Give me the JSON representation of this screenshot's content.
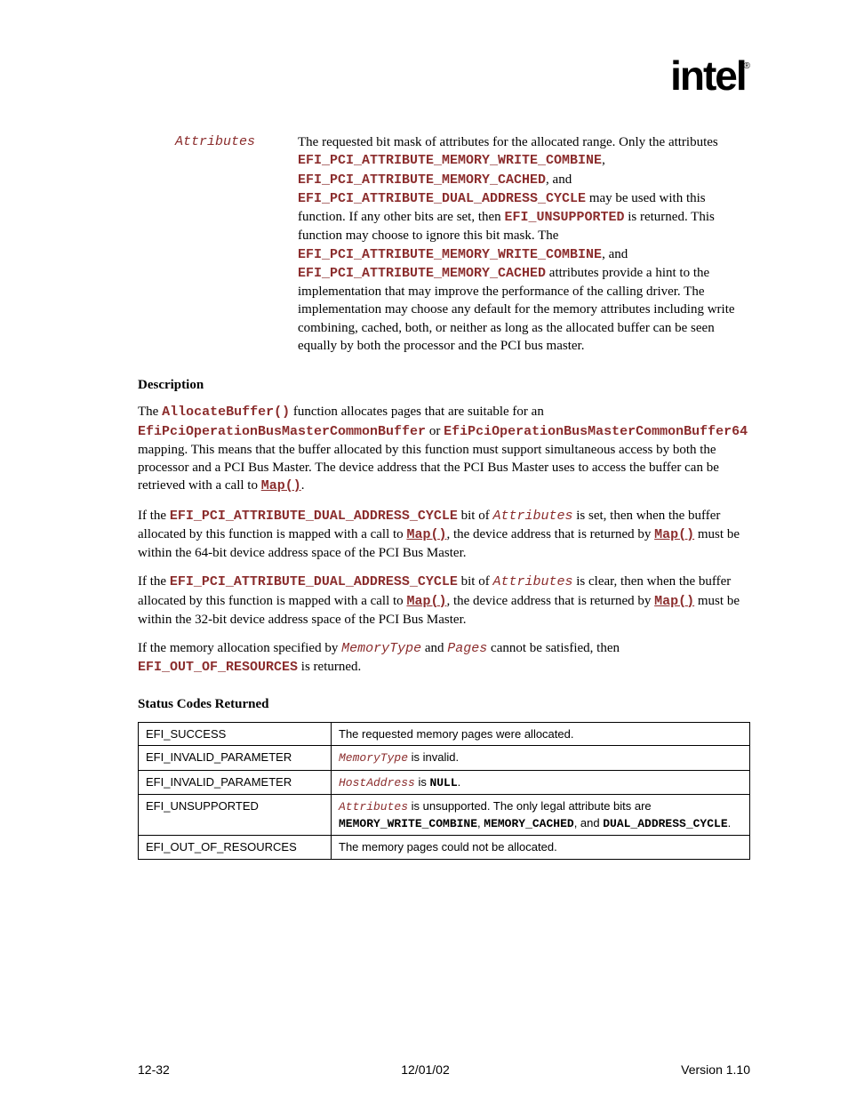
{
  "logo_text": "intel",
  "param": {
    "name": "Attributes",
    "intro1": "The requested bit mask of attributes for the allocated range.  Only the attributes ",
    "const1": "EFI_PCI_ATTRIBUTE_MEMORY_WRITE_COMBINE",
    "sep1": ", ",
    "const2": "EFI_PCI_ATTRIBUTE_MEMORY_CACHED",
    "sep2": ", and ",
    "const3": "EFI_PCI_ATTRIBUTE_DUAL_ADDRESS_CYCLE",
    "text2": " may be used with this function.  If any other bits are set, then ",
    "const4": "EFI_UNSUPPORTED",
    "text3": " is returned.  This function may choose to ignore this bit mask.  The ",
    "const5": "EFI_PCI_ATTRIBUTE_MEMORY_WRITE_COMBINE",
    "sep3": ", and ",
    "const6": "EFI_PCI_ATTRIBUTE_MEMORY_CACHED",
    "text4": " attributes provide a hint to the implementation that may improve the performance of the calling driver.  The implementation may choose any default for the memory attributes including write combining, cached, both, or neither as long as the allocated buffer can be seen equally by both the processor and the PCI bus master."
  },
  "heading1": "Description",
  "p1": {
    "t1": "The ",
    "c1": "AllocateBuffer()",
    "t2": " function allocates pages that are suitable for an ",
    "c2": "EfiPciOperationBusMasterCommonBuffer",
    "t3": " or ",
    "c3": "EfiPciOperationBusMasterCommonBuffer64",
    "t4": " mapping.  This means that the buffer allocated by this function must support simultaneous access by both the processor and a PCI Bus Master.  The device address that the PCI Bus Master uses to access the buffer can be retrieved with a call to ",
    "c4": "Map()",
    "t5": "."
  },
  "p2": {
    "t1": "If the ",
    "c1": "EFI_PCI_ATTRIBUTE_DUAL_ADDRESS_CYCLE",
    "t2": " bit of ",
    "c2": "Attributes",
    "t3": " is set, then when the buffer allocated by this function is mapped with a call to ",
    "c3": "Map()",
    "t4": ", the device address that is returned by ",
    "c4": "Map()",
    "t5": " must be within the 64-bit device address space of the PCI Bus Master."
  },
  "p3": {
    "t1": "If the ",
    "c1": "EFI_PCI_ATTRIBUTE_DUAL_ADDRESS_CYCLE",
    "t2": " bit of ",
    "c2": "Attributes",
    "t3": " is clear, then when the buffer allocated by this function is mapped with a call to ",
    "c3": "Map()",
    "t4": ", the device address that is returned by ",
    "c4": "Map()",
    "t5": " must be within the 32-bit device address space of the PCI Bus Master."
  },
  "p4": {
    "t1": "If the memory allocation specified by ",
    "c1": "MemoryType",
    "t2": " and ",
    "c2": "Pages",
    "t3": " cannot be satisfied, then ",
    "c3": "EFI_OUT_OF_RESOURCES",
    "t4": " is returned."
  },
  "heading2": "Status Codes Returned",
  "status": [
    {
      "code": "EFI_SUCCESS",
      "plain": "The requested memory pages were allocated."
    },
    {
      "code": "EFI_INVALID_PARAMETER",
      "m1": "MemoryType",
      "t1": " is invalid."
    },
    {
      "code": "EFI_INVALID_PARAMETER",
      "m1": "HostAddress",
      "t1": " is ",
      "m2": "NULL",
      "t2": "."
    },
    {
      "code": "EFI_UNSUPPORTED",
      "m1": "Attributes",
      "t1": " is unsupported.  The only legal attribute bits are ",
      "m2": "MEMORY_WRITE_COMBINE",
      "t2": ", ",
      "m3": "MEMORY_CACHED",
      "t3": ", and ",
      "m4": "DUAL_ADDRESS_CYCLE",
      "t4": "."
    },
    {
      "code": "EFI_OUT_OF_RESOURCES",
      "plain": "The memory pages could not be allocated."
    }
  ],
  "footer": {
    "left": "12-32",
    "center": "12/01/02",
    "right": "Version 1.10"
  }
}
